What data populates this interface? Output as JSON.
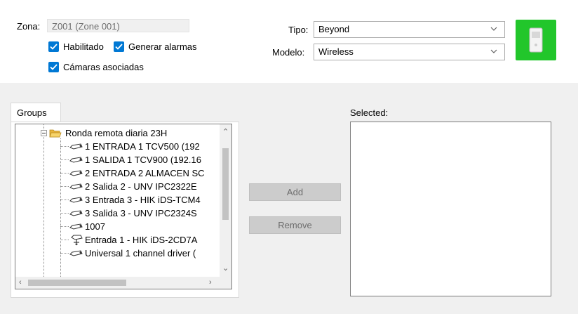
{
  "form": {
    "zona_label": "Zona:",
    "zona_value": "Z001 (Zone 001)",
    "habilitado_label": "Habilitado",
    "generar_alarmas_label": "Generar alarmas",
    "camaras_label": "Cámaras asociadas",
    "tipo_label": "Tipo:",
    "tipo_value": "Beyond",
    "modelo_label": "Modelo:",
    "modelo_value": "Wireless",
    "device_icon": "wireless-sensor-icon"
  },
  "groups": {
    "tab_label": "Groups",
    "folder": "Ronda remota diaria 23H",
    "items": [
      {
        "label": "1 ENTRADA 1 TCV500 (192",
        "icon": "camera-icon"
      },
      {
        "label": "1 SALIDA 1 TCV900 (192.16",
        "icon": "camera-icon"
      },
      {
        "label": "2 ENTRADA 2 ALMACEN SC",
        "icon": "camera-icon"
      },
      {
        "label": "2 Salida 2 - UNV IPC2322E",
        "icon": "camera-icon"
      },
      {
        "label": "3 Entrada 3 - HIK iDS-TCM4",
        "icon": "camera-icon"
      },
      {
        "label": "3 Salida 3 - UNV IPC2324S",
        "icon": "camera-icon"
      },
      {
        "label": "1007",
        "icon": "camera-icon"
      },
      {
        "label": "Entrada 1 - HIK iDS-2CD7A",
        "icon": "ptz-camera-icon"
      },
      {
        "label": "Universal 1 channel driver (",
        "icon": "camera-icon"
      }
    ]
  },
  "buttons": {
    "add": "Add",
    "remove": "Remove"
  },
  "selected": {
    "label": "Selected:"
  },
  "colors": {
    "accent": "#0078d4",
    "device_bg": "#22c62b"
  }
}
